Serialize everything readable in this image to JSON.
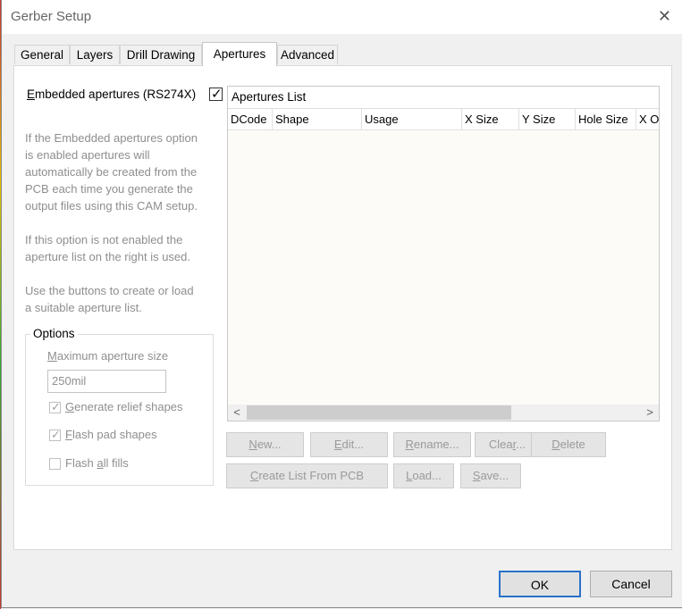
{
  "window": {
    "title": "Gerber Setup",
    "close_glyph": "✕"
  },
  "tabs": [
    {
      "label": "General"
    },
    {
      "label": "Layers"
    },
    {
      "label": "Drill Drawing"
    },
    {
      "label": "Apertures"
    },
    {
      "label": "Advanced"
    }
  ],
  "active_tab": "Apertures",
  "embedded": {
    "label_prefix": "E",
    "label_rest": "mbedded apertures (RS274X)",
    "checked": true
  },
  "help_text": {
    "p1": [
      "If the Embedded apertures option",
      "is enabled apertures will",
      "automatically be created from the",
      "PCB each time you generate the",
      "output files using this CAM setup."
    ],
    "p2": [
      "If this option is not enabled the",
      "aperture list on the right is used."
    ],
    "p3": [
      "Use the buttons to create or load",
      "a suitable aperture list."
    ]
  },
  "options": {
    "title": "Options",
    "max_size_prefix": "M",
    "max_size_rest": "aximum aperture size",
    "max_size_value": "250mil",
    "relief": {
      "prefix": "G",
      "rest": "enerate relief shapes",
      "checked": true
    },
    "flash_pad": {
      "prefix": "F",
      "rest": "lash pad shapes",
      "checked": true
    },
    "flash_fills": {
      "before": "Flash ",
      "ul": "a",
      "after": "ll fills",
      "checked": false
    }
  },
  "list": {
    "caption": "Apertures List",
    "columns": [
      "DCode",
      "Shape",
      "Usage",
      "X Size",
      "Y Size",
      "Hole Size",
      "X O"
    ]
  },
  "scroll": {
    "left_glyph": "<",
    "right_glyph": ">"
  },
  "buttons": {
    "new": {
      "ul": "N",
      "rest": "ew..."
    },
    "edit": {
      "ul": "E",
      "rest": "dit..."
    },
    "rename": {
      "ul": "R",
      "rest": "ename..."
    },
    "clear": {
      "pre": "Clea",
      "ul": "r",
      "rest": "..."
    },
    "delete": {
      "ul": "D",
      "rest": "elete"
    },
    "create": {
      "ul": "C",
      "rest": "reate List From PCB"
    },
    "load": {
      "ul": "L",
      "rest": "oad..."
    },
    "save": {
      "ul": "S",
      "rest": "ave..."
    }
  },
  "footer": {
    "ok": "OK",
    "cancel": "Cancel"
  },
  "colors": {
    "accent": "#2a72c9",
    "list_bg": "#fdfbf7"
  }
}
